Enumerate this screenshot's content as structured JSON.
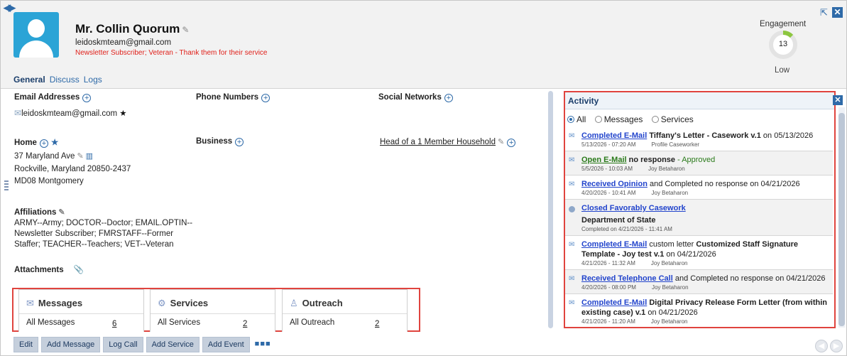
{
  "header": {
    "name": "Mr. Collin Quorum",
    "email": "leidoskmteam@gmail.com",
    "tagline": "Newsletter Subscriber; Veteran - Thank them for their service",
    "tabs": [
      {
        "label": "General",
        "active": true
      },
      {
        "label": "Discuss",
        "active": false
      },
      {
        "label": "Logs",
        "active": false
      }
    ],
    "engagement": {
      "label": "Engagement",
      "score": "13",
      "level": "Low"
    }
  },
  "sections": {
    "email_label": "Email Addresses",
    "email_value": "leidoskmteam@gmail.com",
    "phone_label": "Phone Numbers",
    "social_label": "Social Networks",
    "home_label": "Home",
    "address_line1": "37 Maryland Ave",
    "address_line2": "Rockville, Maryland 20850-2437",
    "address_line3": "MD08 Montgomery",
    "business_label": "Business",
    "household": "Head of a 1 Member Household",
    "affiliations_label": "Affiliations",
    "affiliations_lines": [
      "ARMY--Army; DOCTOR--Doctor; EMAIL.OPTIN--",
      "Newsletter Subscriber; FMRSTAFF--Former",
      "Staffer; TEACHER--Teachers; VET--Veteran"
    ],
    "attachments_label": "Attachments"
  },
  "widgets": [
    {
      "title": "Messages",
      "all_label": "All Messages",
      "count": "6",
      "icon": "envelope-icon"
    },
    {
      "title": "Services",
      "all_label": "All Services",
      "count": "2",
      "icon": "services-icon"
    },
    {
      "title": "Outreach",
      "all_label": "All Outreach",
      "count": "2",
      "icon": "person-icon"
    }
  ],
  "buttons": [
    "Edit",
    "Add Message",
    "Log Call",
    "Add Service",
    "Add Event"
  ],
  "activity": {
    "title": "Activity",
    "filters": [
      {
        "label": "All",
        "selected": true
      },
      {
        "label": "Messages",
        "selected": false
      },
      {
        "label": "Services",
        "selected": false
      }
    ],
    "items": [
      {
        "link": "Completed E-Mail",
        "rest_bold": "Tiffany's Letter - Casework v.1",
        "rest": " on 05/13/2026",
        "date": "5/13/2026 - 07:20 AM",
        "who": "Profile Caseworker"
      },
      {
        "link": "Open E-Mail",
        "rest_bold": "no response",
        "rest": " - Approved",
        "date": "5/5/2026 - 10:03 AM",
        "who": "Joy Betaharon"
      },
      {
        "link": "Received Opinion",
        "rest_bold": "",
        "rest": " and Completed no response on 04/21/2026",
        "date": "4/20/2026 - 10:41 AM",
        "who": "Joy Betaharon"
      },
      {
        "link": "Closed Favorably Casework",
        "line2": "Department of State",
        "date": "Completed on 4/21/2026 - 11:41 AM",
        "who": ""
      },
      {
        "link": "Completed E-Mail",
        "rest_pre": " custom letter ",
        "rest_bold": "Customized Staff Signature Template - Joy test v.1",
        "rest": " on 04/21/2026",
        "date": "4/21/2026 - 11:32 AM",
        "who": "Joy Betaharon"
      },
      {
        "link": "Received Telephone Call",
        "rest_bold": "",
        "rest": " and Completed no response on 04/21/2026",
        "date": "4/20/2026 - 08:00 PM",
        "who": "Joy Betaharon"
      },
      {
        "link": "Completed E-Mail",
        "rest_bold": "Digital Privacy Release Form Letter (from within existing case) v.1",
        "rest": " on 04/21/2026",
        "date": "4/21/2026 - 11:20 AM",
        "who": "Joy Betaharon"
      }
    ]
  }
}
